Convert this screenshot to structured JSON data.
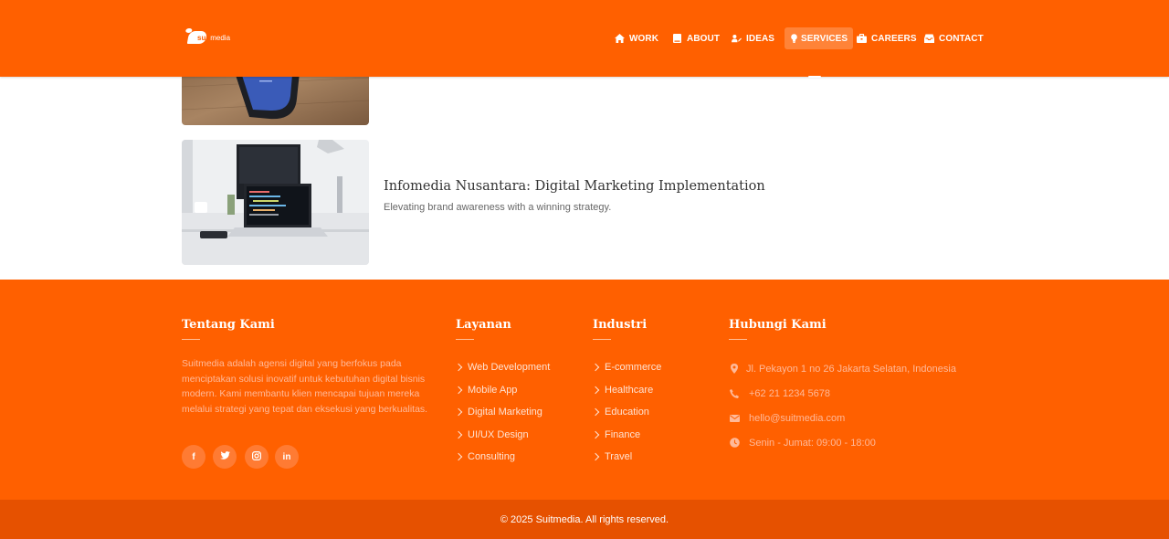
{
  "brand": {
    "logo_text": "suitmedia",
    "logo_lead": "suit",
    "logo_tail": "media"
  },
  "nav": {
    "items": [
      {
        "label": "WORK",
        "icon": "home-icon"
      },
      {
        "label": "ABOUT",
        "icon": "book-icon"
      },
      {
        "label": "IDEAS",
        "icon": "user-edit-icon"
      },
      {
        "label": "SERVICES",
        "icon": "lightbulb-icon",
        "active": true
      },
      {
        "label": "CAREERS",
        "icon": "briefcase-icon"
      },
      {
        "label": "CONTACT",
        "icon": "inbox-icon"
      }
    ]
  },
  "content": {
    "card2": {
      "title": "Infomedia Nusantara: Digital Marketing Implementation",
      "description": "Elevating brand awareness with a winning strategy."
    }
  },
  "footer": {
    "about": {
      "title": "Tentang Kami",
      "text": "Suitmedia adalah agensi digital yang berfokus pada menciptakan solusi inovatif untuk kebutuhan digital bisnis modern. Kami membantu klien mencapai tujuan mereka melalui strategi yang tepat dan eksekusi yang berkualitas.",
      "social": [
        {
          "icon": "facebook-icon",
          "glyph": "f"
        },
        {
          "icon": "twitter-icon",
          "glyph": "t"
        },
        {
          "icon": "instagram-icon",
          "glyph": "ig"
        },
        {
          "icon": "linkedin-icon",
          "glyph": "in"
        }
      ]
    },
    "services": {
      "title": "Layanan",
      "items": [
        "Web Development",
        "Mobile App",
        "Digital Marketing",
        "UI/UX Design",
        "Consulting"
      ]
    },
    "industries": {
      "title": "Industri",
      "items": [
        "E-commerce",
        "Healthcare",
        "Education",
        "Finance",
        "Travel"
      ]
    },
    "contact": {
      "title": "Hubungi Kami",
      "address": "Jl. Pekayon 1 no 26 Jakarta Selatan, Indonesia",
      "phone": "+62 21 1234 5678",
      "email": "hello@suitmedia.com",
      "hours": "Senin - Jumat: 09:00 - 18:00"
    },
    "copyright": "© 2025 Suitmedia. All rights reserved."
  },
  "colors": {
    "brand_orange": "#ff6000",
    "copyright_bar": "#e65100"
  }
}
